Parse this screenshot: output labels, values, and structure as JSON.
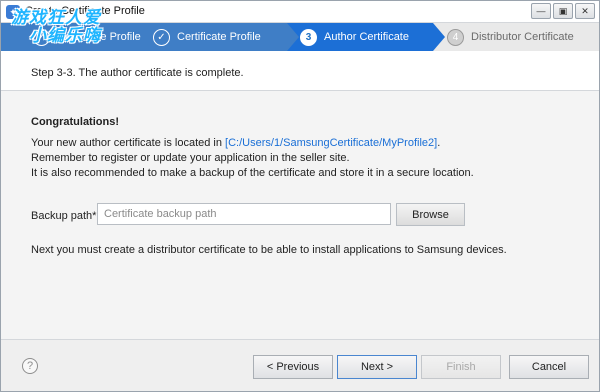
{
  "window": {
    "title": "Create Certificate Profile",
    "minimize_glyph": "—",
    "maximize_glyph": "▣",
    "close_glyph": "✕"
  },
  "watermark": {
    "line1": "游戏狂人爱",
    "line2": "小编乐嗨"
  },
  "steps": [
    {
      "number": "1",
      "label": "Certificate Profile",
      "state": "done"
    },
    {
      "number": "2",
      "label": "Certificate Profile",
      "state": "done"
    },
    {
      "number": "3",
      "label": "Author Certificate",
      "state": "active"
    },
    {
      "number": "4",
      "label": "Distributor Certificate",
      "state": "future"
    }
  ],
  "step_check_glyph": "✓",
  "subheader": "Step 3-3. The author certificate is complete.",
  "content": {
    "heading": "Congratulations!",
    "line1_prefix": "Your new author certificate is located in ",
    "line1_link": "[C:/Users/1/SamsungCertificate/MyProfile2]",
    "line1_suffix": ".",
    "line2": "Remember to register or update your application in the seller site.",
    "line3": "It is also recommended to make a backup of the certificate and store it in a secure location.",
    "backup_label": "Backup path*",
    "backup_placeholder": "Certificate backup path",
    "backup_value": "",
    "browse_label": "Browse",
    "next_info": "Next you must create a distributor certificate to be able to install applications to Samsung devices."
  },
  "footer": {
    "help_glyph": "?",
    "previous_label": "< Previous",
    "next_label": "Next >",
    "finish_label": "Finish",
    "cancel_label": "Cancel"
  },
  "colors": {
    "step_bar": "#3f7ec6",
    "step_active": "#1c6fd6",
    "link": "#1a6fd6"
  }
}
